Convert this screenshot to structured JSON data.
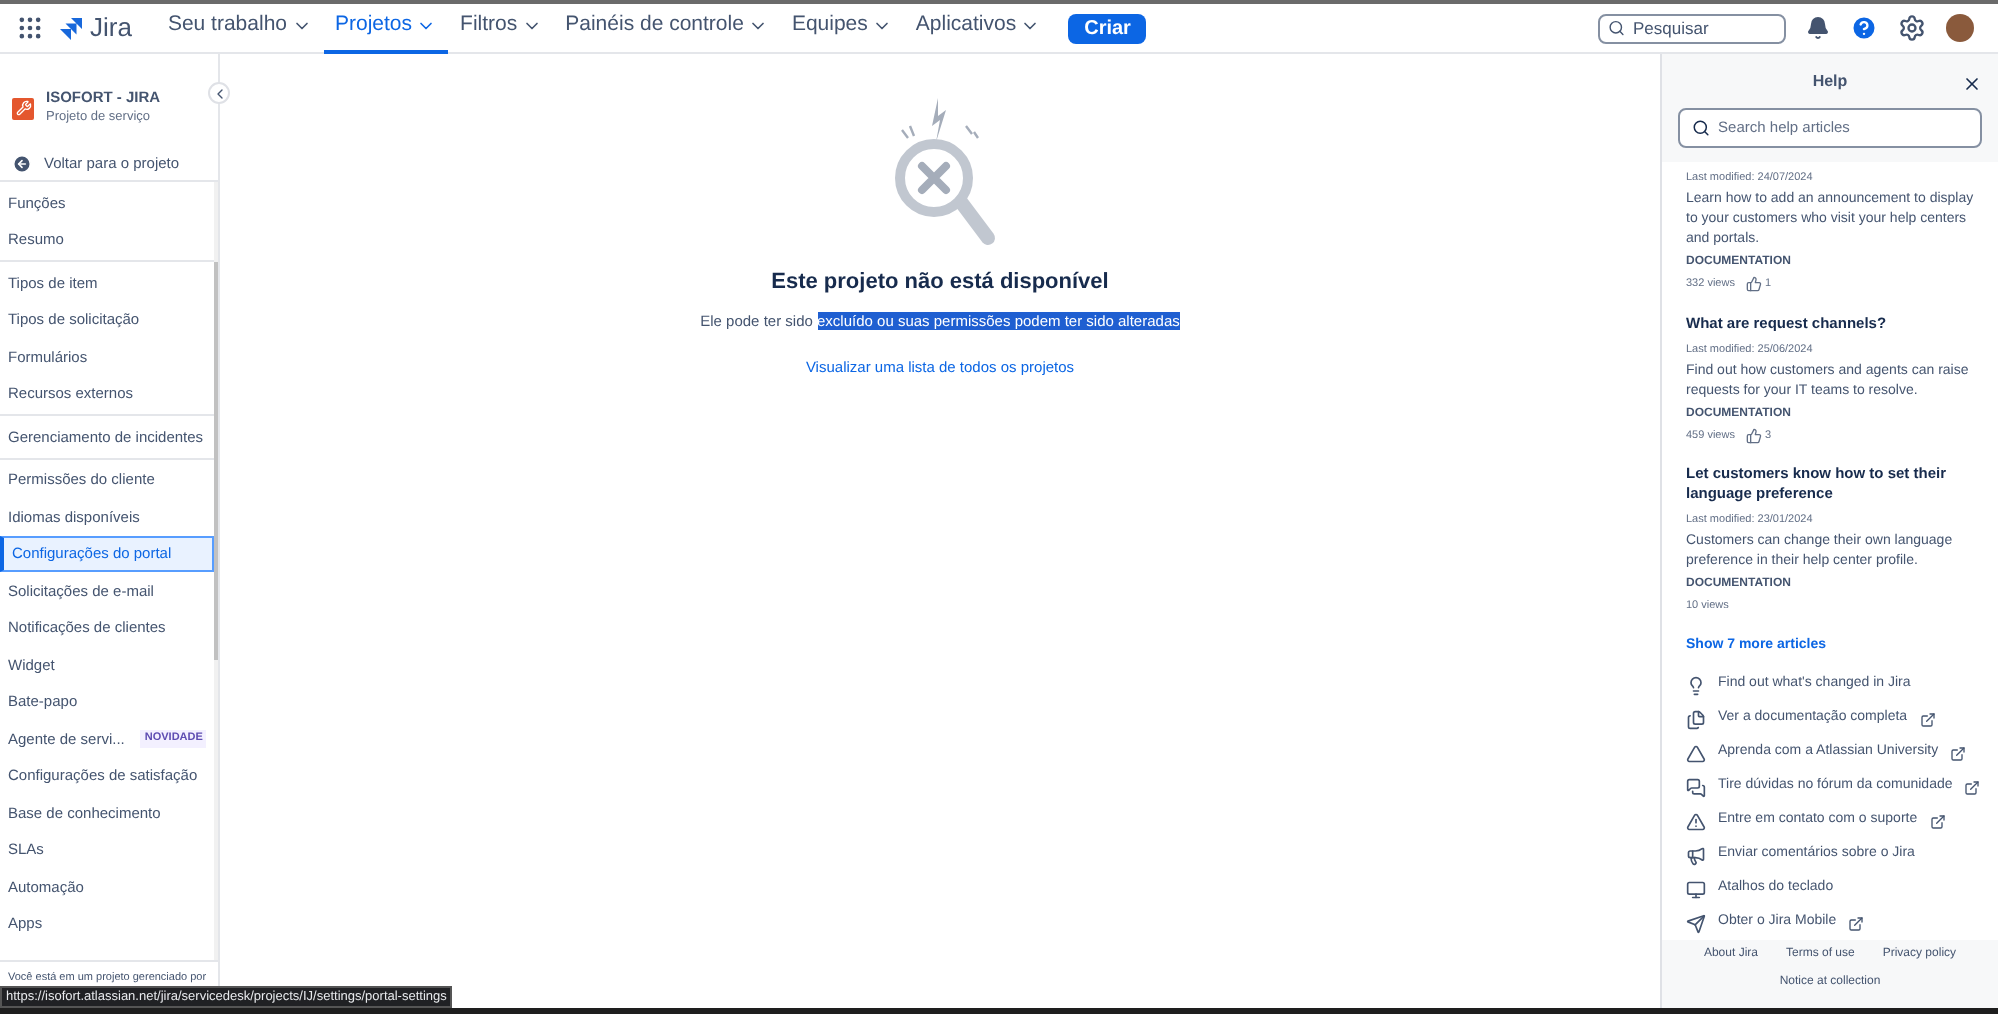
{
  "topbar": {
    "product": "Jira",
    "nav": [
      {
        "label": "Seu trabalho",
        "selected": false
      },
      {
        "label": "Projetos",
        "selected": true
      },
      {
        "label": "Filtros",
        "selected": false
      },
      {
        "label": "Painéis de controle",
        "selected": false
      },
      {
        "label": "Equipes",
        "selected": false
      },
      {
        "label": "Aplicativos",
        "selected": false
      }
    ],
    "create_button": "Criar",
    "search": {
      "placeholder": "Pesquisar"
    }
  },
  "sidebar": {
    "project_name": "ISOFORT - JIRA",
    "project_type": "Projeto de serviço",
    "back_link": "Voltar para o projeto",
    "groups": [
      {
        "items": [
          {
            "label": "Funções",
            "selected": false
          },
          {
            "label": "Resumo",
            "selected": false
          }
        ]
      },
      {
        "items": [
          {
            "label": "Tipos de item",
            "selected": false
          },
          {
            "label": "Tipos de solicitação",
            "selected": false
          },
          {
            "label": "Formulários",
            "selected": false
          },
          {
            "label": "Recursos externos",
            "selected": false
          }
        ]
      },
      {
        "items": [
          {
            "label": "Gerenciamento de incidentes",
            "selected": false
          }
        ]
      },
      {
        "items": [
          {
            "label": "Permissões do cliente",
            "selected": false
          },
          {
            "label": "Idiomas disponíveis",
            "selected": false
          },
          {
            "label": "Configurações do portal",
            "selected": true
          },
          {
            "label": "Solicitações de e-mail",
            "selected": false
          },
          {
            "label": "Notificações de clientes",
            "selected": false
          },
          {
            "label": "Widget",
            "selected": false
          },
          {
            "label": "Bate-papo",
            "selected": false
          },
          {
            "label": "Agente de servi...",
            "selected": false,
            "badge": "NOVIDADE"
          },
          {
            "label": "Configurações de satisfação",
            "selected": false
          },
          {
            "label": "Base de conhecimento",
            "selected": false
          },
          {
            "label": "SLAs",
            "selected": false
          },
          {
            "label": "Automação",
            "selected": false
          },
          {
            "label": "Apps",
            "selected": false
          }
        ]
      }
    ],
    "footer": "Você está em um projeto gerenciado por"
  },
  "main": {
    "title": "Este projeto não está disponível",
    "description": "Ele pode ter sido",
    "description_selected": "excluído ou suas permissões podem ter sido alteradas",
    "link": "Visualizar uma lista de todos os projetos"
  },
  "help": {
    "title": "Help",
    "search": {
      "placeholder": "Search help articles"
    },
    "articles": [
      {
        "modified": "Last modified: 24/07/2024",
        "summary": "Learn how to add an announcement to display to your customers who visit your help centers and portals.",
        "tag": "DOCUMENTATION",
        "views": "332 views",
        "likes": "1"
      },
      {
        "title": "What are request channels?",
        "modified": "Last modified: 25/06/2024",
        "summary": "Find out how customers and agents can raise requests for your IT teams to resolve.",
        "tag": "DOCUMENTATION",
        "views": "459 views",
        "likes": "3"
      },
      {
        "title": "Let customers know how to set their language preference",
        "modified": "Last modified: 23/01/2024",
        "summary": "Customers can change their own language preference in their help center profile.",
        "tag": "DOCUMENTATION",
        "views": "10 views"
      }
    ],
    "show_more": "Show 7 more articles",
    "links": [
      {
        "label": "Find out what's changed in Jira",
        "external": false
      },
      {
        "label": "Ver a documentação completa",
        "external": true
      },
      {
        "label": "Aprenda com a Atlassian University",
        "external": true
      },
      {
        "label": "Tire dúvidas no fórum da comunidade",
        "external": true
      },
      {
        "label": "Entre em contato com o suporte",
        "external": true
      },
      {
        "label": "Enviar comentários sobre o Jira",
        "external": false
      },
      {
        "label": "Atalhos do teclado",
        "external": false
      },
      {
        "label": "Obter o Jira Mobile",
        "external": true
      }
    ],
    "footer_links": [
      "About Jira",
      "Terms of use",
      "Privacy policy",
      "Notice at collection"
    ]
  },
  "status_url": "https://isofort.atlassian.net/jira/servicedesk/projects/IJ/settings/portal-settings"
}
